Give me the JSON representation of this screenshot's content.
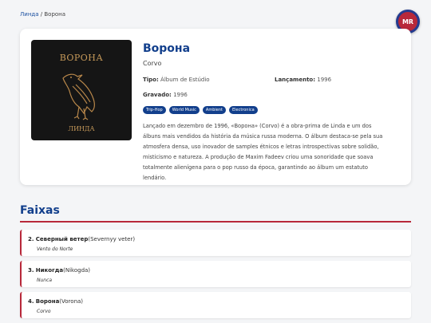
{
  "breadcrumb": {
    "artist": "Линда",
    "separator": "/",
    "current": "Ворона"
  },
  "logo": {
    "text": "MR",
    "colors": {
      "fill": "#b8283a",
      "ring": "#243b8f"
    }
  },
  "album": {
    "cover_title": "ВОРОНА",
    "cover_artist": "ЛИНДА",
    "title": "Ворона",
    "subtitle": "Corvo",
    "type_label": "Tipo:",
    "type_value": "Álbum de Estúdio",
    "release_label": "Lançamento:",
    "release_value": "1996",
    "recorded_label": "Gravado:",
    "recorded_value": "1996",
    "tags": [
      "Trip-Hop",
      "World Music",
      "Ambient",
      "Electronica"
    ],
    "description": "Lançado em dezembro de 1996, «Ворона» (Corvo) é a obra-prima de Linda e um dos álbuns mais vendidos da história da música russa moderna. O álbum destaca-se pela sua atmosfera densa, uso inovador de samples étnicos e letras introspectivas sobre solidão, misticismo e natureza. A produção de Maxim Fadeev criou uma sonoridade que soava totalmente alienígena para o pop russo da época, garantindo ao álbum um estatuto lendário."
  },
  "tracks_section": {
    "title": "Faixas",
    "tracks": [
      {
        "number": "2.",
        "title": "Северный ветер",
        "translit": "(Severnyy veter)",
        "translation": "Vento do Norte"
      },
      {
        "number": "3.",
        "title": "Никогда",
        "translit": "(Nikogda)",
        "translation": "Nunca"
      },
      {
        "number": "4.",
        "title": "Ворона",
        "translit": "(Vorona)",
        "translation": "Corvo"
      }
    ]
  },
  "colors": {
    "accent_blue": "#123f8c",
    "accent_red": "#b8283a"
  }
}
